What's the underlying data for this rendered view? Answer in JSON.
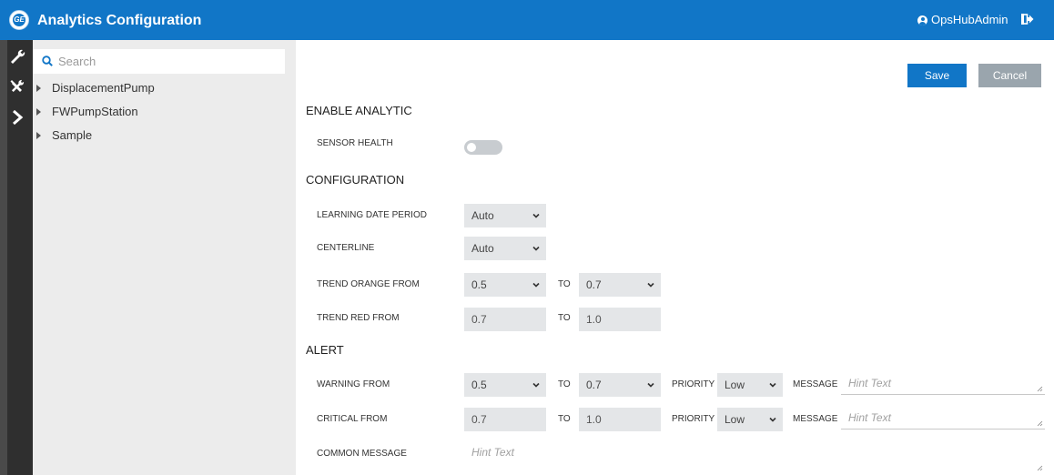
{
  "header": {
    "logo_text": "GE",
    "title": "Analytics Configuration",
    "user": "OpsHubAdmin"
  },
  "rail": {
    "icons": [
      "wrench-icon",
      "tools-icon",
      "chevron-right-icon"
    ]
  },
  "tree": {
    "search_placeholder": "Search",
    "items": [
      {
        "label": "DisplacementPump"
      },
      {
        "label": "FWPumpStation"
      },
      {
        "label": "Sample"
      }
    ]
  },
  "toolbar": {
    "save_label": "Save",
    "cancel_label": "Cancel"
  },
  "enable_analytic": {
    "heading": "ENABLE ANALYTIC",
    "sensor_health_label": "SENSOR HEALTH",
    "sensor_health_on": false
  },
  "configuration": {
    "heading": "CONFIGURATION",
    "learning_date_period": {
      "label": "LEARNING DATE PERIOD",
      "value": "Auto"
    },
    "centerline": {
      "label": "CENTERLINE",
      "value": "Auto"
    },
    "trend_orange": {
      "label": "TREND ORANGE FROM",
      "from": "0.5",
      "to_label": "TO",
      "to": "0.7"
    },
    "trend_red": {
      "label": "TREND RED FROM",
      "from": "0.7",
      "to_label": "TO",
      "to": "1.0"
    }
  },
  "alert": {
    "heading": "ALERT",
    "warning": {
      "label": "WARNING FROM",
      "from": "0.5",
      "to_label": "TO",
      "to": "0.7",
      "priority_label": "PRIORITY",
      "priority": "Low",
      "message_label": "MESSAGE",
      "message_placeholder": "Hint Text"
    },
    "critical": {
      "label": "CRITICAL FROM",
      "from": "0.7",
      "to_label": "TO",
      "to": "1.0",
      "priority_label": "PRIORITY",
      "priority": "Low",
      "message_label": "MESSAGE",
      "message_placeholder": "Hint Text"
    },
    "common_message": {
      "label": "COMMON MESSAGE",
      "placeholder": "Hint Text"
    }
  },
  "colors": {
    "header": "#1176c7",
    "primary_button": "#1176c7",
    "secondary_button": "#9aa5ad",
    "rail": "#2f2f2f",
    "tree_panel": "#ececec"
  }
}
